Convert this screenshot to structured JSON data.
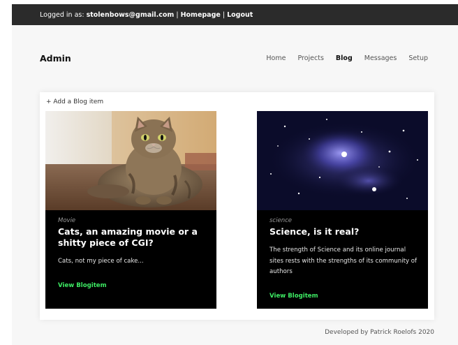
{
  "topbar": {
    "prefix": "Logged in as: ",
    "email": "stolenbows@gmail.com",
    "sep1": " | ",
    "homepage": "Homepage",
    "sep2": " | ",
    "logout": "Logout"
  },
  "brand": "Admin",
  "nav": {
    "items": [
      {
        "label": "Home",
        "active": false
      },
      {
        "label": "Projects",
        "active": false
      },
      {
        "label": "Blog",
        "active": true
      },
      {
        "label": "Messages",
        "active": false
      },
      {
        "label": "Setup",
        "active": false
      }
    ]
  },
  "blog": {
    "add_label": "+ Add a Blog item",
    "cards": [
      {
        "category": "Movie",
        "title": "Cats, an amazing movie or a shitty piece of CGI?",
        "text": "Cats, not my piece of cake...",
        "link": "View Blogitem"
      },
      {
        "category": "science",
        "title": "Science, is it real?",
        "text": "The strength of Science and its online journal sites rests with the strengths of its community of authors",
        "link": "View Blogitem"
      }
    ]
  },
  "footer": "Developed by Patrick Roelofs 2020",
  "colors": {
    "topbar_bg": "#2b2b2b",
    "link_accent": "#3dea63",
    "card_bg": "#000000"
  }
}
